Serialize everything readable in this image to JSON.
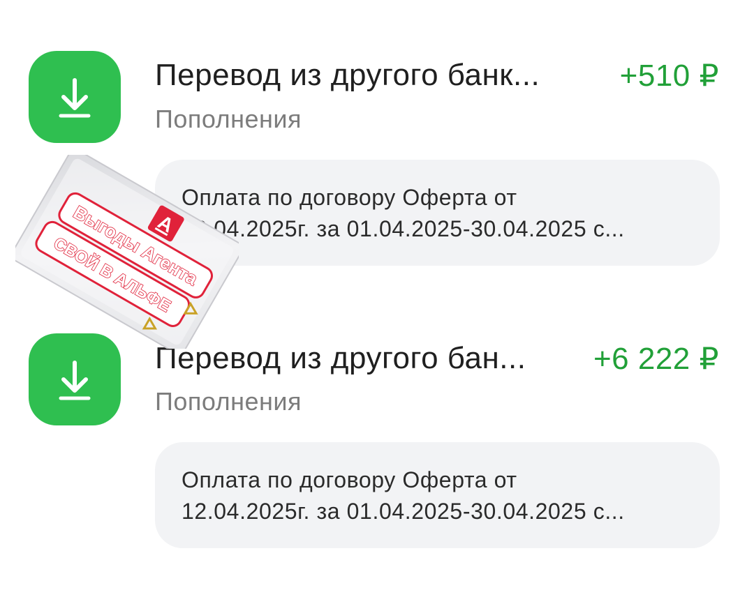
{
  "transactions": [
    {
      "title": "Перевод из другого банк...",
      "amount": "+510 ₽",
      "category": "Пополнения",
      "comment_line1": "Оплата по договору Оферта от",
      "comment_line2": "12.04.2025г. за 01.04.2025-30.04.2025 с...",
      "icon": "download-icon"
    },
    {
      "title": "Перевод из другого бан...",
      "amount": "+6 222 ₽",
      "category": "Пополнения",
      "comment_line1": "Оплата по договору Оферта от",
      "comment_line2": "12.04.2025г. за 01.04.2025-30.04.2025 с...",
      "icon": "download-icon"
    }
  ],
  "sticker": {
    "logo_letter": "А",
    "line1": "Выгоды Агента",
    "line2": "СВОЙ В АЛЬФЕ"
  },
  "colors": {
    "icon_bg": "#2fbf50",
    "amount": "#21a038",
    "comment_bg": "#f2f3f5",
    "sticker_red": "#e0223a"
  }
}
